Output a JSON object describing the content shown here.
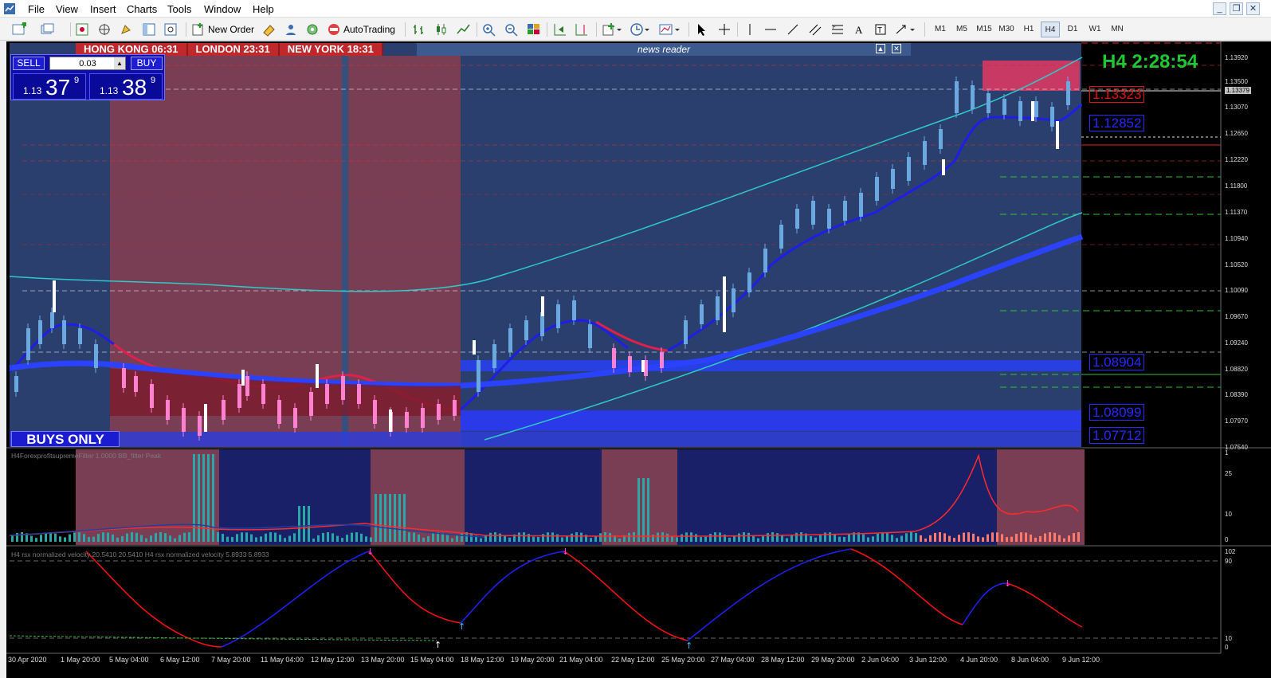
{
  "menu": {
    "items": [
      "File",
      "View",
      "Insert",
      "Charts",
      "Tools",
      "Window",
      "Help"
    ]
  },
  "toolbar": {
    "new_order": "New Order",
    "autotrading": "AutoTrading",
    "timeframes": [
      "M1",
      "M5",
      "M15",
      "M30",
      "H1",
      "H4",
      "D1",
      "W1",
      "MN"
    ],
    "active_timeframe": "H4"
  },
  "chart": {
    "sessions": [
      {
        "city": "HONG KONG",
        "time": "06:31"
      },
      {
        "city": "LONDON",
        "time": "23:31"
      },
      {
        "city": "NEW YORK",
        "time": "18:31"
      }
    ],
    "news_reader": "news reader",
    "timer": "H4 2:28:54",
    "trade_panel": {
      "sell_label": "SELL",
      "buy_label": "BUY",
      "lot": "0.03",
      "bid_prefix": "1.13",
      "bid_big": "37",
      "bid_sup": "9",
      "ask_prefix": "1.13",
      "ask_big": "38",
      "ask_sup": "9"
    },
    "buys_only": "BUYS ONLY",
    "price_boxes": [
      "1.13323",
      "1.12852",
      "1.08904",
      "1.08099",
      "1.07712"
    ],
    "price_axis": [
      "1.13920",
      "1.13500",
      "1.13379",
      "1.13070",
      "1.12650",
      "1.12220",
      "1.11800",
      "1.11370",
      "1.10940",
      "1.10520",
      "1.10090",
      "1.09670",
      "1.09240",
      "1.08820",
      "1.08390",
      "1.07970",
      "1.07540"
    ],
    "time_axis": [
      "30 Apr 2020",
      "1 May 20:00",
      "5 May 04:00",
      "6 May 12:00",
      "7 May 20:00",
      "11 May 04:00",
      "12 May 12:00",
      "13 May 20:00",
      "15 May 04:00",
      "18 May 12:00",
      "19 May 20:00",
      "21 May 04:00",
      "22 May 12:00",
      "25 May 20:00",
      "27 May 04:00",
      "28 May 12:00",
      "29 May 20:00",
      "2 Jun 04:00",
      "3 Jun 12:00",
      "4 Jun 20:00",
      "8 Jun 04:00",
      "9 Jun 12:00"
    ],
    "sub1": {
      "label": "H4ForexprofitsupremeFilter 1.0000  BB_filter  Peak",
      "axis": [
        "1",
        "25",
        "10",
        "0"
      ]
    },
    "sub2": {
      "label": "H4 rsx normalized velocity 20.5410 20.5410  H4 rsx normalized velocity 5.8933 5.8933",
      "axis": [
        "102",
        "90",
        "10",
        "0"
      ]
    },
    "colors": {
      "up_trend": "#1e1ee6",
      "down_trend": "#e0204a",
      "bull_zone": "#2a3f6e",
      "bear_zone": "#7a3e54",
      "timer": "#1ec832"
    }
  }
}
